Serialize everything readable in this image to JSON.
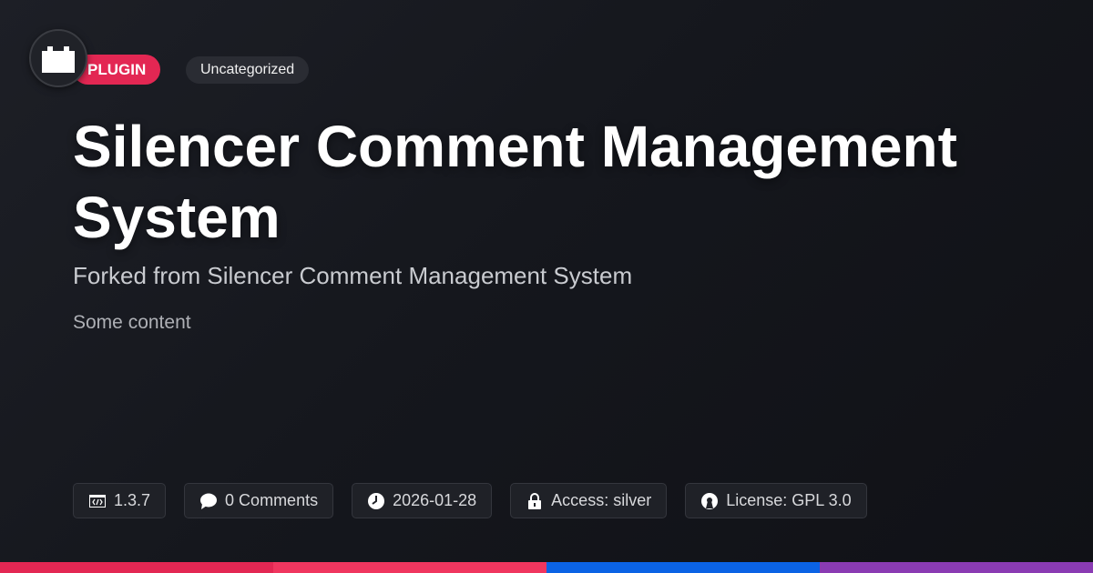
{
  "badge": {
    "type_label": "PLUGIN",
    "category_label": "Uncategorized"
  },
  "title": "Silencer Comment Management System",
  "subtitle": "Forked from Silencer Comment Management System",
  "content": "Some content",
  "meta": {
    "version": "1.3.7",
    "comments": "0 Comments",
    "date": "2026-01-28",
    "access": "Access: silver",
    "license": "License: GPL 3.0"
  },
  "icons": {
    "logo": "plug-block-icon",
    "version": "code-window-icon",
    "comments": "speech-bubble-icon",
    "date": "clock-icon",
    "access": "lock-icon",
    "license": "open-source-icon"
  },
  "colors": {
    "accent": "#e32753",
    "bar": [
      "#e32753",
      "#f0365f",
      "#0b63e5",
      "#8a3bb3"
    ]
  }
}
